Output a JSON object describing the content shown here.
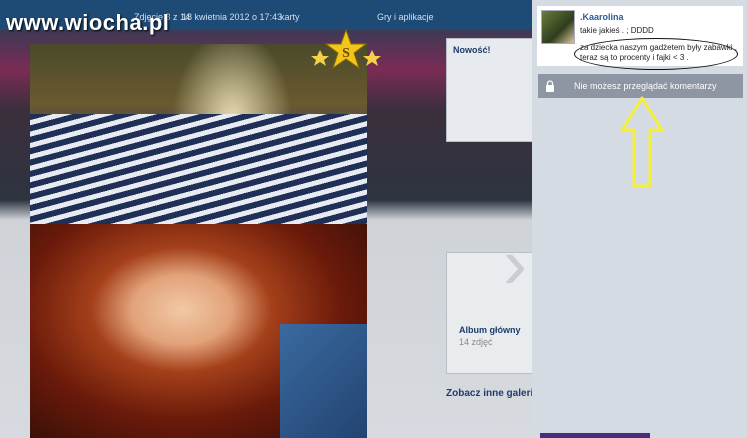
{
  "watermark": "www.wiocha.pl",
  "nav": {
    "photo_counter": "Zdjęcie 3 z 14",
    "date": "18 kwietnia 2012 o 17:43",
    "item_1": "karty",
    "item_2": "Gry i aplikacje"
  },
  "sidebar_cards": {
    "news_title": "Nowość!",
    "album_title": "Album główny",
    "album_count": "14 zdjęć",
    "others_title": "Zobacz inne galerie"
  },
  "comment": {
    "username": ".Kaarolina",
    "line_1": "takie jakieś . ; DDDD",
    "line_2": "za dziecka naszym gadżetem były zabawki ,",
    "line_3": "teraz są to procenty i fajki < 3 ."
  },
  "comment_locked_text": "Nie możesz przeglądać komentarzy",
  "colors": {
    "arrow": "#f4ef3a",
    "panel": "#d4dbe3",
    "link": "#2c5c9a"
  },
  "icons": [
    "star-badge-icon",
    "lock-icon",
    "next-arrow-icon",
    "up-arrow-annotation"
  ]
}
